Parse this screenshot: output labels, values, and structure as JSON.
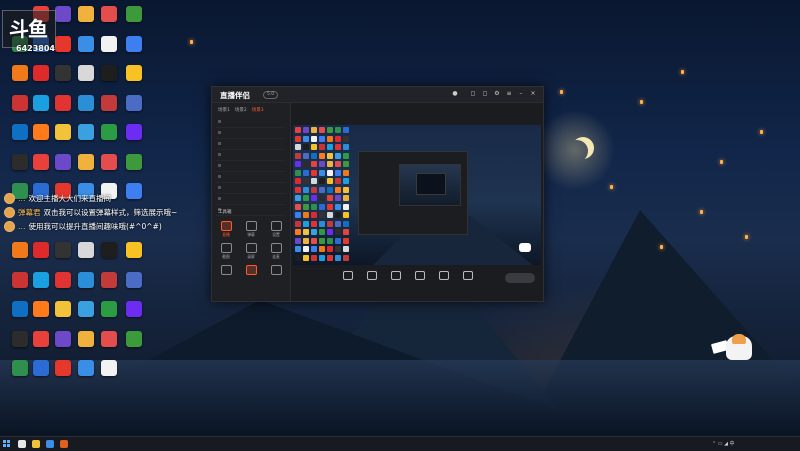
{
  "overlay": {
    "logo": "斗鱼",
    "room_id": "6423804"
  },
  "chat": [
    {
      "user": "…",
      "text": "欢迎主播大大们来直播间"
    },
    {
      "user": "弹幕君",
      "text": "双击我可以设置弹幕样式，筛选展示哦~"
    },
    {
      "user": "…",
      "text": "使用我可以提升直播间趣味哦(#^0^#)"
    }
  ],
  "desktop_icons": [
    {
      "label": "",
      "color": "#e8413b"
    },
    {
      "label": "",
      "color": "#6b49c8"
    },
    {
      "label": "",
      "color": "#f0b23c"
    },
    {
      "label": "",
      "color": "#e44d4d"
    },
    {
      "label": "",
      "color": "#3c9a3c"
    },
    {
      "label": "",
      "color": "#2f8f4f"
    },
    {
      "label": "",
      "color": "#2a6bd6"
    },
    {
      "label": "",
      "color": "#e6372c"
    },
    {
      "label": "",
      "color": "#3a8ee6"
    },
    {
      "label": "",
      "color": "#f2f2f2"
    },
    {
      "label": "",
      "color": "#3d7ff0"
    },
    {
      "label": "",
      "color": "#f07a1a"
    },
    {
      "label": "",
      "color": "#de2a2a"
    },
    {
      "label": "",
      "color": "#333"
    },
    {
      "label": "",
      "color": "#d8d8d8"
    },
    {
      "label": "",
      "color": "#1e1e1e"
    },
    {
      "label": "",
      "color": "#f7c324"
    },
    {
      "label": "",
      "color": "#cc3333"
    },
    {
      "label": "",
      "color": "#1aa0e0"
    },
    {
      "label": "",
      "color": "#e23333"
    },
    {
      "label": "",
      "color": "#2a8fd6"
    },
    {
      "label": "",
      "color": "#c23a3a"
    },
    {
      "label": "",
      "color": "#4a6cc4"
    },
    {
      "label": "",
      "color": "#0f6fc2"
    },
    {
      "label": "",
      "color": "#ff7a1a"
    },
    {
      "label": "",
      "color": "#f2c23a"
    },
    {
      "label": "",
      "color": "#3aa0e0"
    },
    {
      "label": "",
      "color": "#2b9c44"
    },
    {
      "label": "",
      "color": "#6c2cf2"
    },
    {
      "label": "",
      "color": "#2c2c2c"
    }
  ],
  "app": {
    "title": "直播伴侣",
    "version": "5.0",
    "left_tabs": [
      "场景1",
      "场景2",
      "场景3"
    ],
    "scenes": [
      "",
      "",
      "",
      "",
      "",
      "",
      "",
      "",
      ""
    ],
    "tools_title": "工具箱",
    "tools": [
      {
        "label": "直播",
        "active": true
      },
      {
        "label": "弹幕",
        "active": false
      },
      {
        "label": "设置",
        "active": false
      },
      {
        "label": "截图",
        "active": false
      },
      {
        "label": "录屏",
        "active": false
      },
      {
        "label": "连麦",
        "active": false
      },
      {
        "label": "",
        "active": false
      },
      {
        "label": "",
        "active": true
      },
      {
        "label": "",
        "active": false
      }
    ],
    "footer": "",
    "main_title": "",
    "main_tag": "",
    "main_sub": "",
    "controls": [
      "",
      "",
      "",
      "",
      "",
      ""
    ],
    "start_live": ""
  },
  "taskbar": {
    "pins": [
      "#e8e8e8",
      "#f0c23a",
      "#3a8ee6",
      "#e06020"
    ],
    "time": "",
    "date": ""
  }
}
